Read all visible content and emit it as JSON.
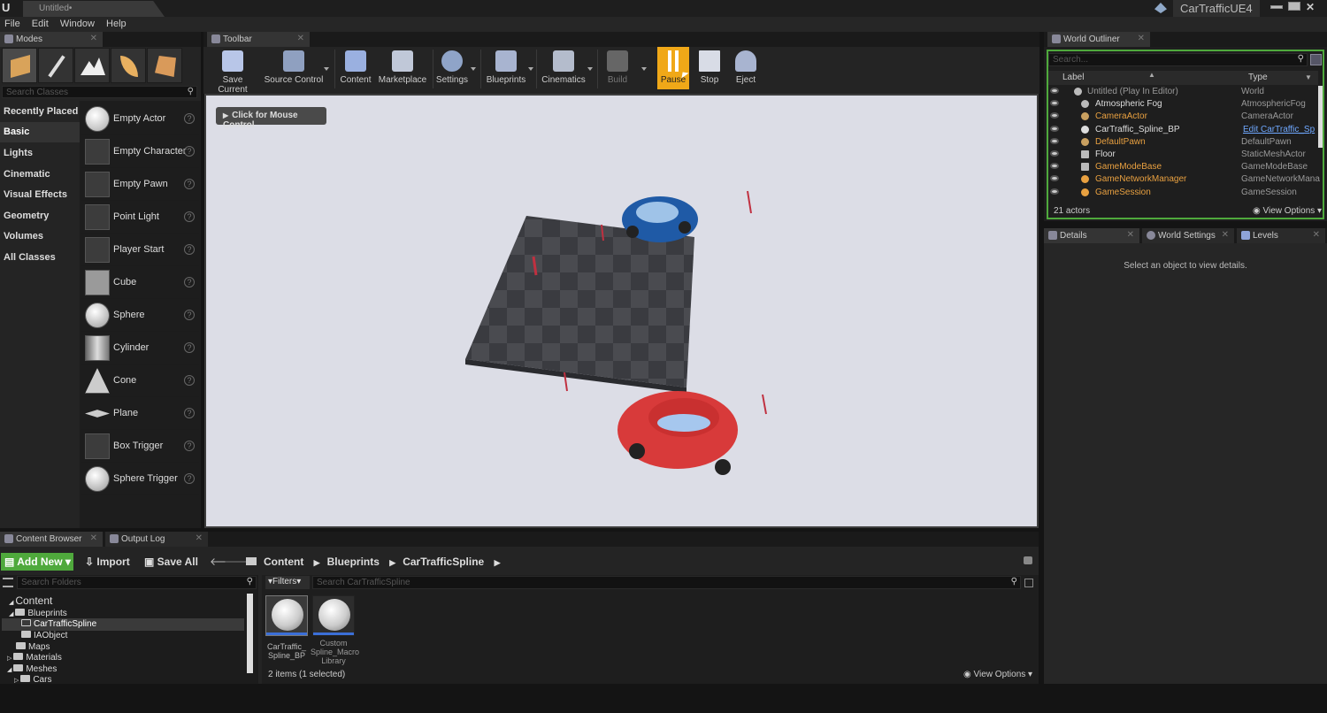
{
  "title_bar": {
    "doc_tab": "Untitled•",
    "project_name": "CarTrafficUE4"
  },
  "menu": [
    "File",
    "Edit",
    "Window",
    "Help"
  ],
  "modes": {
    "tab_label": "Modes",
    "search_placeholder": "Search Classes",
    "categories": [
      "Recently Placed",
      "Basic",
      "Lights",
      "Cinematic",
      "Visual Effects",
      "Geometry",
      "Volumes",
      "All Classes"
    ],
    "items": [
      "Empty Actor",
      "Empty Character",
      "Empty Pawn",
      "Point Light",
      "Player Start",
      "Cube",
      "Sphere",
      "Cylinder",
      "Cone",
      "Plane",
      "Box Trigger",
      "Sphere Trigger"
    ],
    "help_glyph": "?"
  },
  "toolbar": {
    "tab_label": "Toolbar",
    "buttons": [
      "Save Current",
      "Source Control",
      "Content",
      "Marketplace",
      "Settings",
      "Blueprints",
      "Cinematics",
      "Build",
      "Pause",
      "Stop",
      "Eject"
    ]
  },
  "viewport": {
    "mouse_control": "Click for Mouse Control"
  },
  "outliner": {
    "tab_label": "World Outliner",
    "search_placeholder": "Search...",
    "col_label": "Label",
    "col_type": "Type",
    "rows": [
      {
        "label": "Untitled (Play In Editor)",
        "type": "World"
      },
      {
        "label": "Atmospheric Fog",
        "type": "AtmosphericFog"
      },
      {
        "label": "CameraActor",
        "type": "CameraActor"
      },
      {
        "label": "CarTraffic_Spline_BP",
        "type": "Edit CarTraffic_Sp"
      },
      {
        "label": "DefaultPawn",
        "type": "DefaultPawn"
      },
      {
        "label": "Floor",
        "type": "StaticMeshActor"
      },
      {
        "label": "GameModeBase",
        "type": "GameModeBase"
      },
      {
        "label": "GameNetworkManager",
        "type": "GameNetworkMana"
      },
      {
        "label": "GameSession",
        "type": "GameSession"
      }
    ],
    "actor_count": "21 actors",
    "view_options": "View Options"
  },
  "details": {
    "tabs": [
      "Details",
      "World Settings",
      "Levels"
    ],
    "empty_message": "Select an object to view details."
  },
  "content_browser": {
    "tabs": [
      "Content Browser",
      "Output Log"
    ],
    "add_new": "Add New",
    "import": "Import",
    "save_all": "Save All",
    "path": [
      "Content",
      "Blueprints",
      "CarTrafficSpline"
    ],
    "folder_search_placeholder": "Search Folders",
    "filters": "Filters",
    "asset_search_placeholder": "Search CarTrafficSpline",
    "tree": [
      "Content",
      "Blueprints",
      "CarTrafficSpline",
      "IAObject",
      "Maps",
      "Materials",
      "Meshes",
      "Cars"
    ],
    "assets": [
      {
        "label": "CarTraffic_Spline_BP",
        "line1": "CarTraffic_",
        "line2": "Spline_BP"
      },
      {
        "label": "Custom Spline_Macro Library",
        "line1": "Custom",
        "line2": "Spline_Macro",
        "line3": "Library"
      }
    ],
    "status": "2 items (1 selected)",
    "view_options": "View Options"
  }
}
